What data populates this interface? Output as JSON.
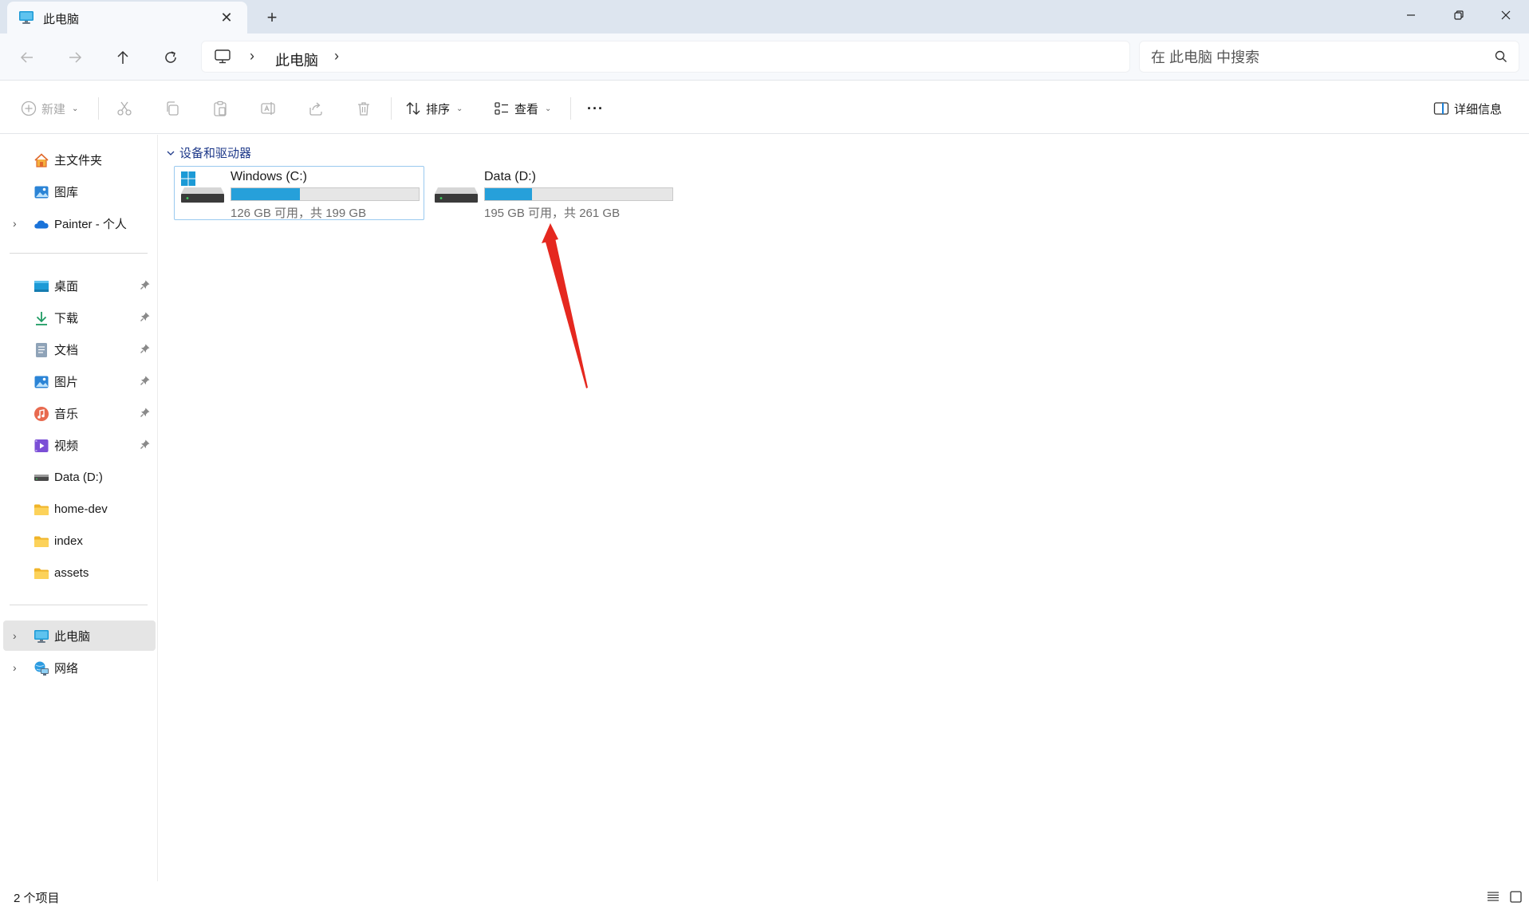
{
  "tab": {
    "title": "此电脑",
    "close": "✕",
    "new_tab": "+"
  },
  "window_controls": {
    "minimize": "minimize",
    "maximize": "restore",
    "close": "close"
  },
  "nav": {
    "back": "back-arrow",
    "forward": "forward-arrow",
    "up": "up-arrow",
    "refresh": "refresh",
    "breadcrumb": [
      "此电脑"
    ],
    "separator": "›"
  },
  "search": {
    "placeholder": "在 此电脑 中搜索"
  },
  "toolbar": {
    "new_label": "新建",
    "sort_label": "排序",
    "view_label": "查看",
    "more_label": "···",
    "details_label": "详细信息",
    "chevron": "⌄"
  },
  "sidebar": {
    "quick": [
      {
        "label": "主文件夹",
        "icon": "home-icon"
      },
      {
        "label": "图库",
        "icon": "gallery-icon"
      },
      {
        "label": "Painter - 个人",
        "icon": "onedrive-icon",
        "expandable": true
      }
    ],
    "pinned": [
      {
        "label": "桌面",
        "icon": "desktop-icon",
        "pinned": true
      },
      {
        "label": "下载",
        "icon": "download-icon",
        "pinned": true
      },
      {
        "label": "文档",
        "icon": "document-icon",
        "pinned": true
      },
      {
        "label": "图片",
        "icon": "pictures-icon",
        "pinned": true
      },
      {
        "label": "音乐",
        "icon": "music-icon",
        "pinned": true
      },
      {
        "label": "视频",
        "icon": "video-icon",
        "pinned": true
      },
      {
        "label": "Data (D:)",
        "icon": "drive-icon"
      },
      {
        "label": "home-dev",
        "icon": "folder-icon"
      },
      {
        "label": "index",
        "icon": "folder-icon"
      },
      {
        "label": "assets",
        "icon": "folder-icon"
      }
    ],
    "locations": [
      {
        "label": "此电脑",
        "icon": "this-pc-icon",
        "selected": true
      },
      {
        "label": "网络",
        "icon": "network-icon"
      }
    ],
    "expander": "›"
  },
  "content": {
    "group_title": "设备和驱动器",
    "group_chevron": "⌄",
    "drives": [
      {
        "name": "Windows (C:)",
        "info": "126 GB 可用，共 199 GB",
        "used_fraction": 0.367,
        "selected": true,
        "icon": "windows-drive-icon"
      },
      {
        "name": "Data (D:)",
        "info": "195 GB 可用，共 261 GB",
        "used_fraction": 0.253,
        "selected": false,
        "icon": "drive-icon"
      }
    ]
  },
  "status": {
    "count": "2 个项目"
  },
  "colors": {
    "accent": "#26a0da",
    "selection_border": "#99c9ef",
    "annotation": "#e5281f",
    "group_title": "#1f3a8a"
  }
}
